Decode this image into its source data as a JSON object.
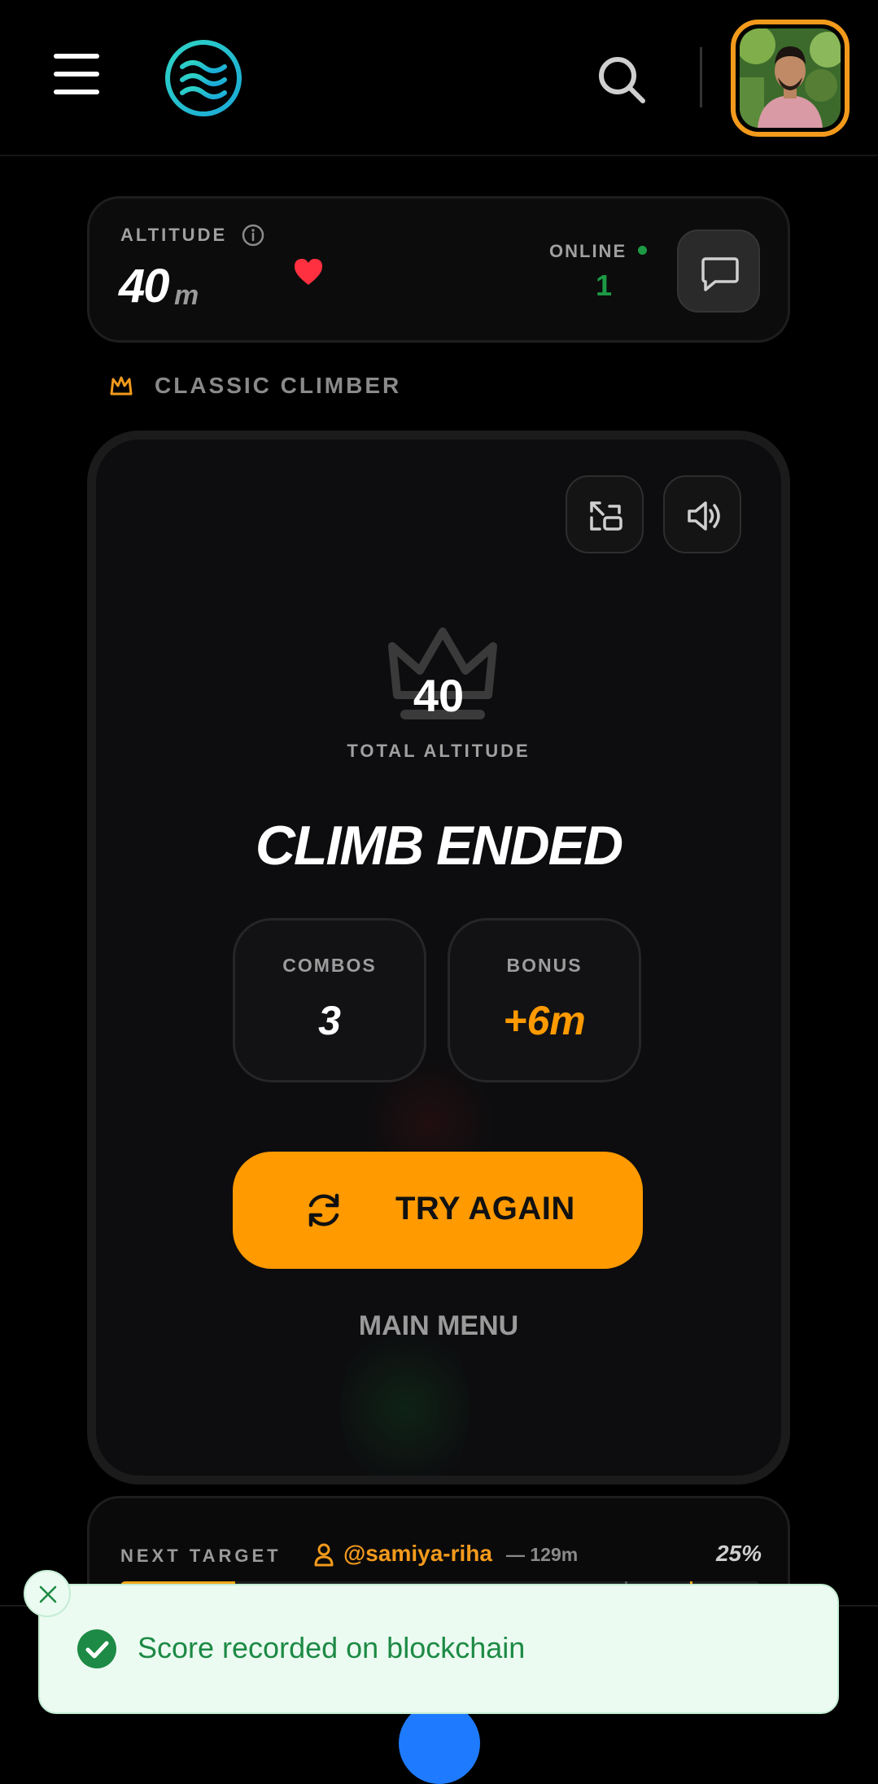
{
  "header": {
    "menu_icon": "hamburger-menu-icon",
    "logo_icon": "waves-logo-icon",
    "search_icon": "search-icon",
    "avatar": "user-avatar-photo",
    "avatar_border_color": "#f39a1c"
  },
  "stats": {
    "altitude_label": "ALTITUDE",
    "altitude_value": "40",
    "altitude_unit": "m",
    "online_label": "ONLINE",
    "online_count": "1",
    "online_color": "#1c9a45",
    "heart_color": "#ff3040"
  },
  "mode": {
    "label": "CLASSIC CLIMBER",
    "icon": "crown-outline-icon"
  },
  "game": {
    "total_value": "40",
    "total_label": "TOTAL ALTITUDE",
    "title": "CLIMB ENDED",
    "combos_label": "COMBOS",
    "combos_value": "3",
    "bonus_label": "BONUS",
    "bonus_value": "+6m",
    "bonus_color": "#ff9a00",
    "try_again_label": "TRY AGAIN",
    "main_menu_label": "MAIN MENU",
    "accent_color": "#ff9a00"
  },
  "target": {
    "label": "NEXT TARGET",
    "user": "@samiya-riha",
    "distance": "— 129m",
    "percent": "25%",
    "progress_fraction": 0.18
  },
  "toast": {
    "message": "Score recorded on blockchain",
    "color": "#1d8a45"
  }
}
